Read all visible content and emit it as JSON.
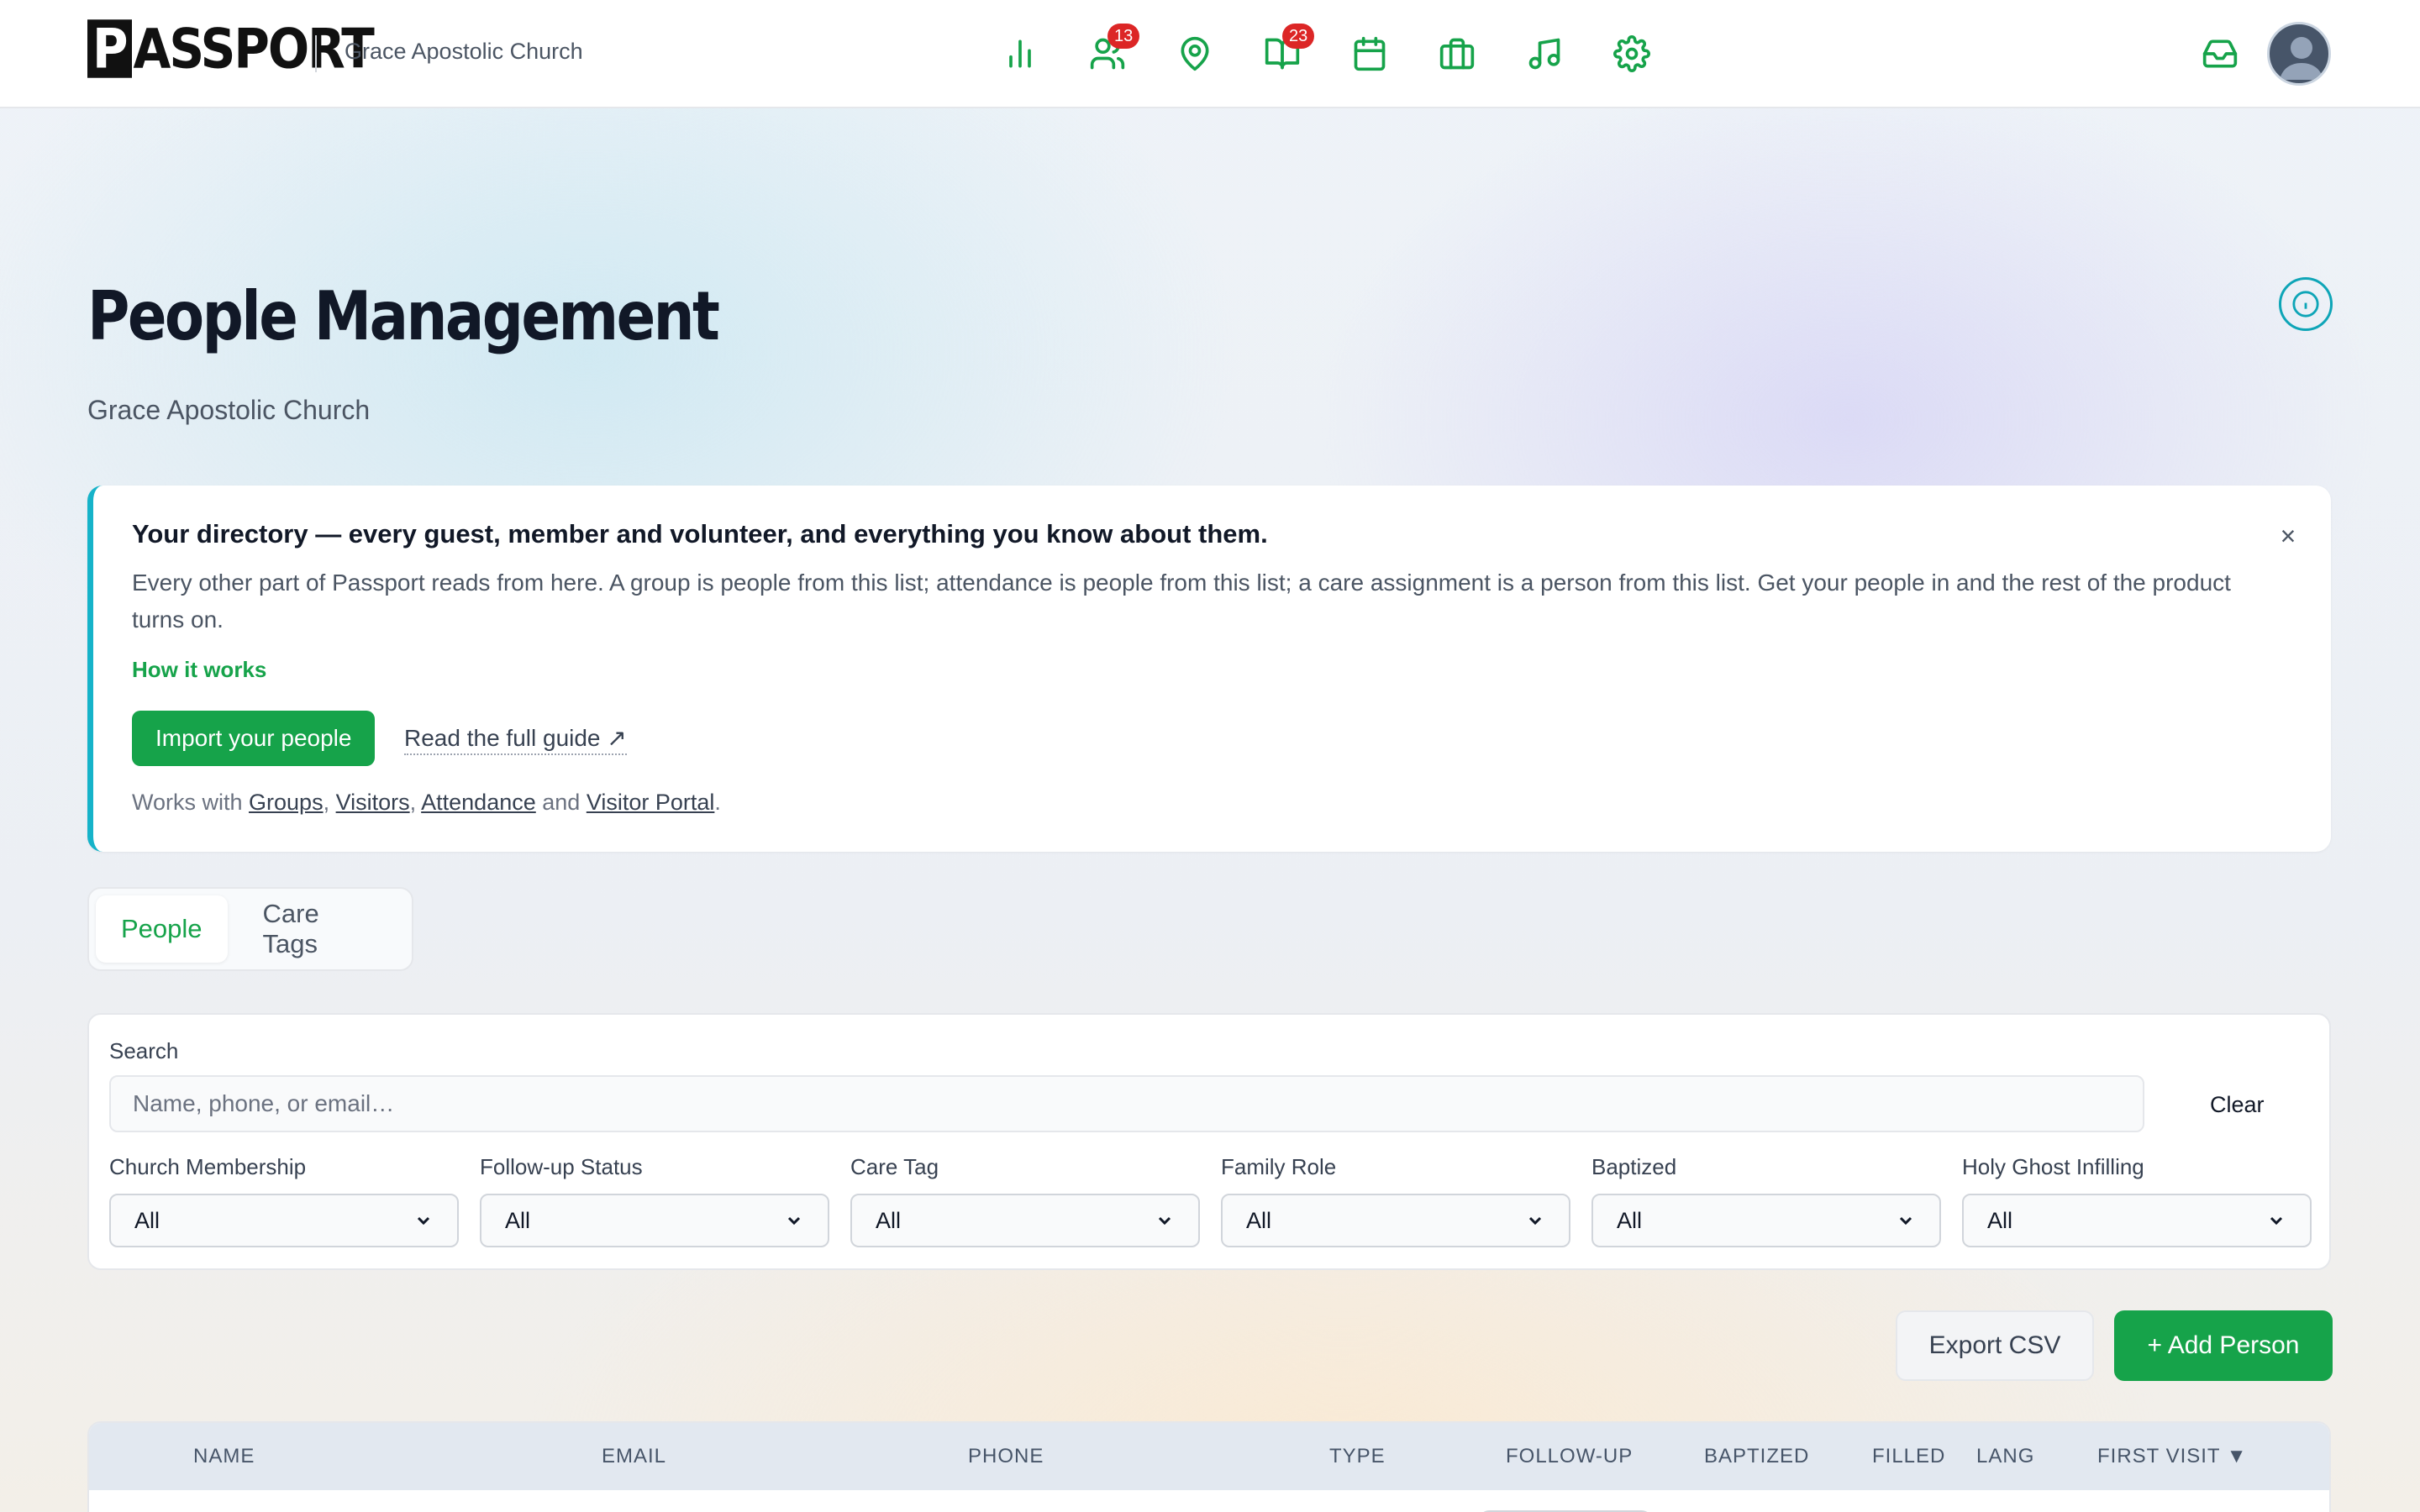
{
  "topbar": {
    "logo_text": "PASSPORT",
    "church_name": "Grace Apostolic Church",
    "nav_icons": [
      {
        "icon": "bar-chart-icon"
      },
      {
        "icon": "users-icon",
        "badge": "13"
      },
      {
        "icon": "map-pin-icon"
      },
      {
        "icon": "book-open-icon",
        "badge": "23"
      },
      {
        "icon": "calendar-icon"
      },
      {
        "icon": "briefcase-icon"
      },
      {
        "icon": "music-icon"
      },
      {
        "icon": "gear-icon"
      }
    ],
    "accent_color": "#16a34a"
  },
  "header": {
    "title": "People Management",
    "subtitle": "Grace Apostolic Church"
  },
  "banner": {
    "title": "Your directory — every guest, member and volunteer, and everything you know about them.",
    "close": "×",
    "body": "Every other part of Passport reads from here. A group is people from this list; attendance is people from this list; a care assignment is a person from this list. Get your people in and the rest of the product turns on.",
    "how_link": "How it works",
    "import_button": "Import your people",
    "guide_link": "Read the full guide ↗",
    "works_prefix": "Works with ",
    "works_links": [
      "Groups",
      "Visitors",
      "Attendance",
      "Visitor Portal"
    ],
    "works_sep1": ", ",
    "works_sep2": ", ",
    "works_and": " and ",
    "works_suffix": "."
  },
  "tabs": [
    {
      "label": "People",
      "active": true
    },
    {
      "label": "Care Tags",
      "active": false
    }
  ],
  "filters": {
    "search_label": "Search",
    "search_placeholder": "Name, phone, or email…",
    "clear_label": "Clear",
    "selects": [
      {
        "label": "Church Membership",
        "value": "All"
      },
      {
        "label": "Follow-up Status",
        "value": "All"
      },
      {
        "label": "Care Tag",
        "value": "All"
      },
      {
        "label": "Family Role",
        "value": "All"
      },
      {
        "label": "Baptized",
        "value": "All"
      },
      {
        "label": "Holy Ghost Infilling",
        "value": "All"
      }
    ]
  },
  "actions": {
    "export_label": "Export CSV",
    "add_label": "+ Add Person"
  },
  "table": {
    "columns": [
      "NAME",
      "EMAIL",
      "PHONE",
      "TYPE",
      "FOLLOW-UP",
      "BAPTIZED",
      "FILLED",
      "LANG",
      "FIRST VISIT ▼"
    ]
  }
}
